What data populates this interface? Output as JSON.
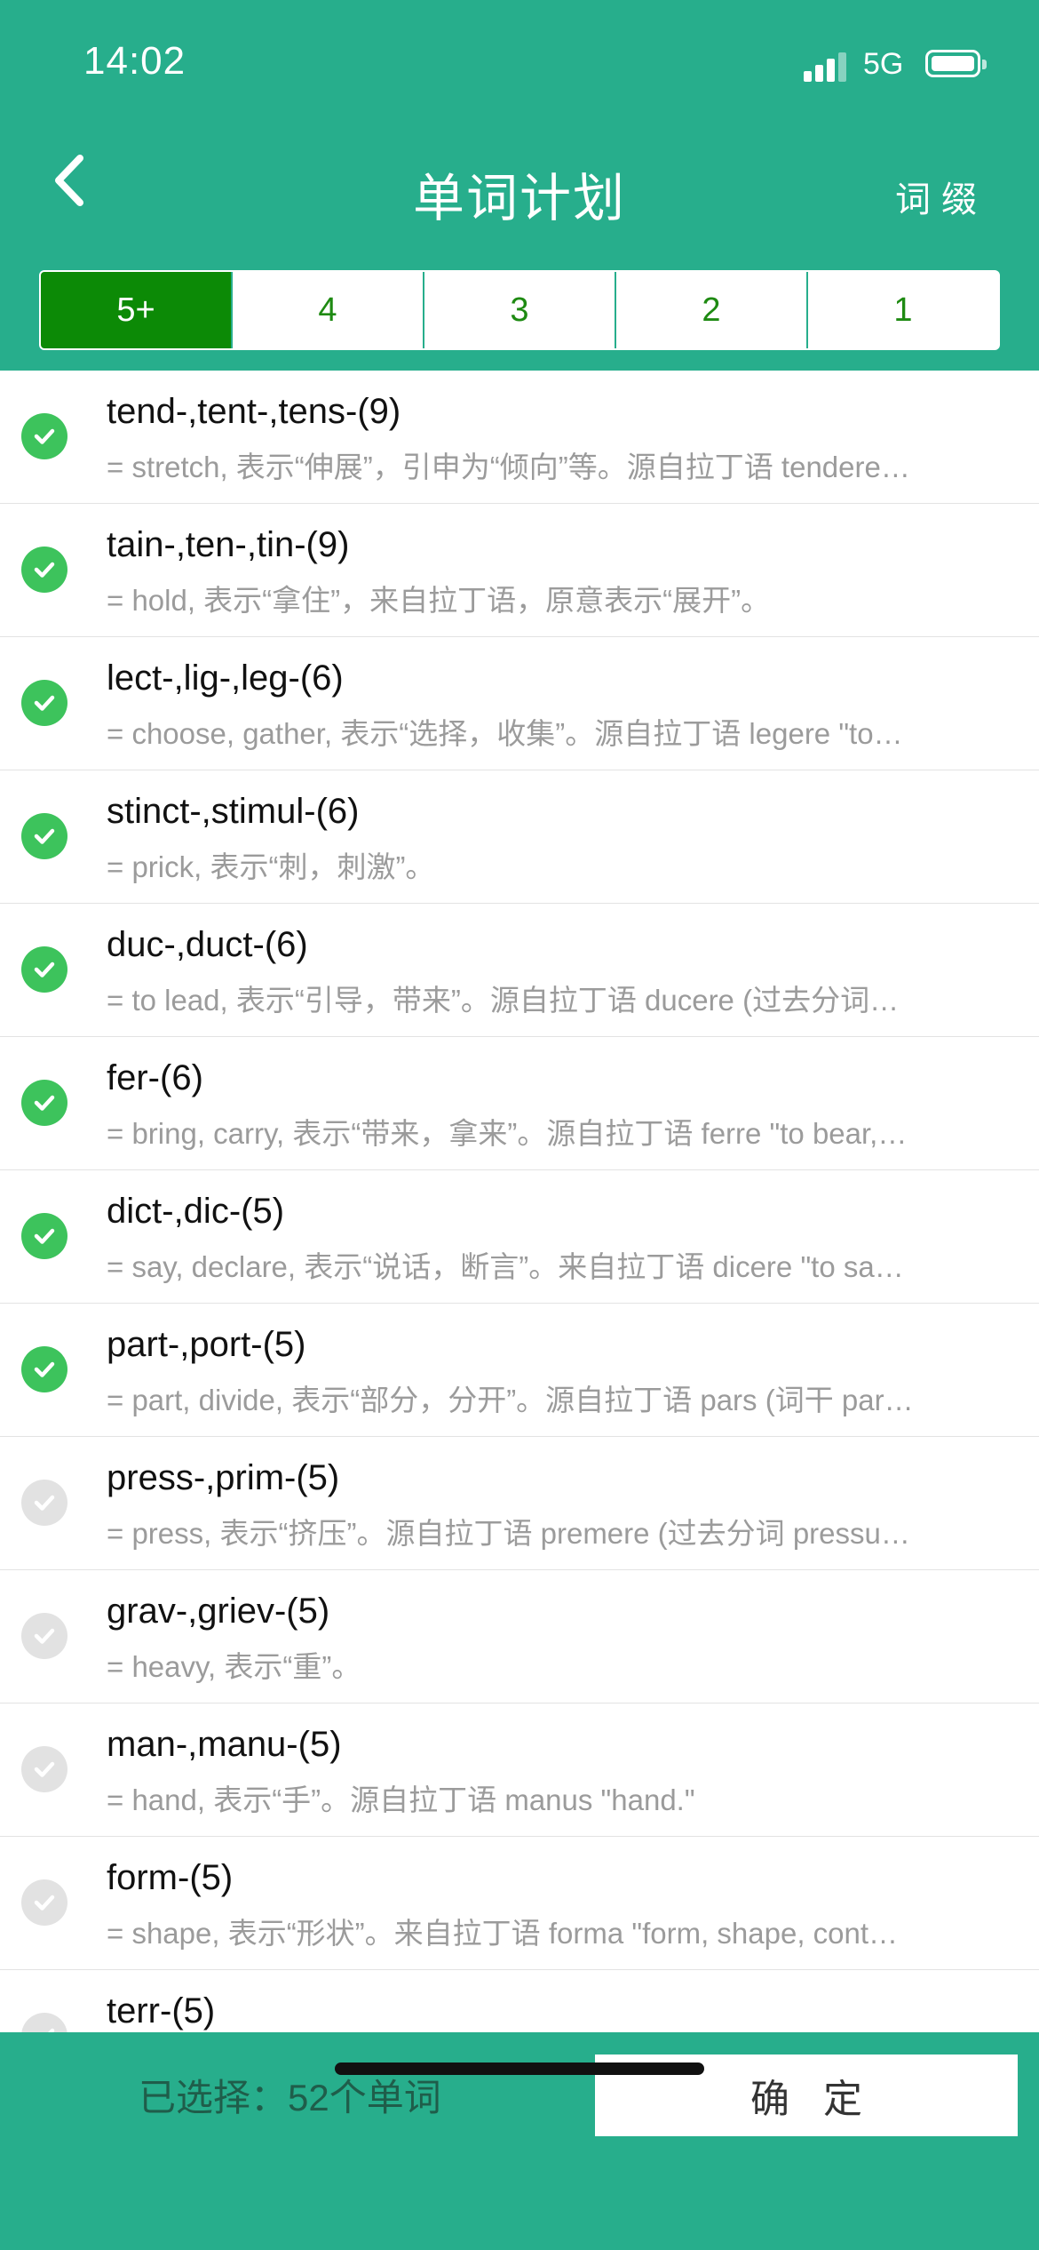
{
  "status": {
    "time": "14:02",
    "network": "5G"
  },
  "header": {
    "title": "单词计划",
    "right_action": "词缀"
  },
  "tabs": [
    {
      "label": "5+",
      "active": true
    },
    {
      "label": "4",
      "active": false
    },
    {
      "label": "3",
      "active": false
    },
    {
      "label": "2",
      "active": false
    },
    {
      "label": "1",
      "active": false
    }
  ],
  "items": [
    {
      "word": "tend-,tent-,tens-(9)",
      "desc": "= stretch, 表示“伸展”，引申为“倾向”等。源自拉丁语 tendere…",
      "checked": true
    },
    {
      "word": "tain-,ten-,tin-(9)",
      "desc": "= hold, 表示“拿住”，来自拉丁语，原意表示“展开”。",
      "checked": true
    },
    {
      "word": "lect-,lig-,leg-(6)",
      "desc": "= choose, gather, 表示“选择，收集”。源自拉丁语 legere \"to…",
      "checked": true
    },
    {
      "word": "stinct-,stimul-(6)",
      "desc": "= prick, 表示“刺，刺激”。",
      "checked": true
    },
    {
      "word": "duc-,duct-(6)",
      "desc": "= to lead, 表示“引导，带来”。源自拉丁语 ducere (过去分词…",
      "checked": true
    },
    {
      "word": "fer-(6)",
      "desc": "= bring, carry, 表示“带来，拿来”。源自拉丁语 ferre \"to bear,…",
      "checked": true
    },
    {
      "word": "dict-,dic-(5)",
      "desc": "= say, declare, 表示“说话，断言”。来自拉丁语 dicere \"to sa…",
      "checked": true
    },
    {
      "word": "part-,port-(5)",
      "desc": "= part, divide, 表示“部分，分开”。源自拉丁语 pars (词干 par…",
      "checked": true
    },
    {
      "word": "press-,prim-(5)",
      "desc": "= press, 表示“挤压”。源自拉丁语 premere (过去分词 pressu…",
      "checked": false
    },
    {
      "word": "grav-,griev-(5)",
      "desc": "= heavy, 表示“重”。",
      "checked": false
    },
    {
      "word": "man-,manu-(5)",
      "desc": "= hand, 表示“手”。源自拉丁语 manus \"hand.\"",
      "checked": false
    },
    {
      "word": "form-(5)",
      "desc": "= shape, 表示“形状”。来自拉丁语 forma \"form, shape, cont…",
      "checked": false
    },
    {
      "word": "terr-(5)",
      "desc": "",
      "checked": false
    }
  ],
  "footer": {
    "selected_text": "已选择：52个单词",
    "confirm_label": "确定"
  },
  "colors": {
    "brand": "#27AE8C",
    "active_tab": "#0C8A06",
    "check_on": "#3DC35C",
    "check_off": "#E2E2E2"
  }
}
